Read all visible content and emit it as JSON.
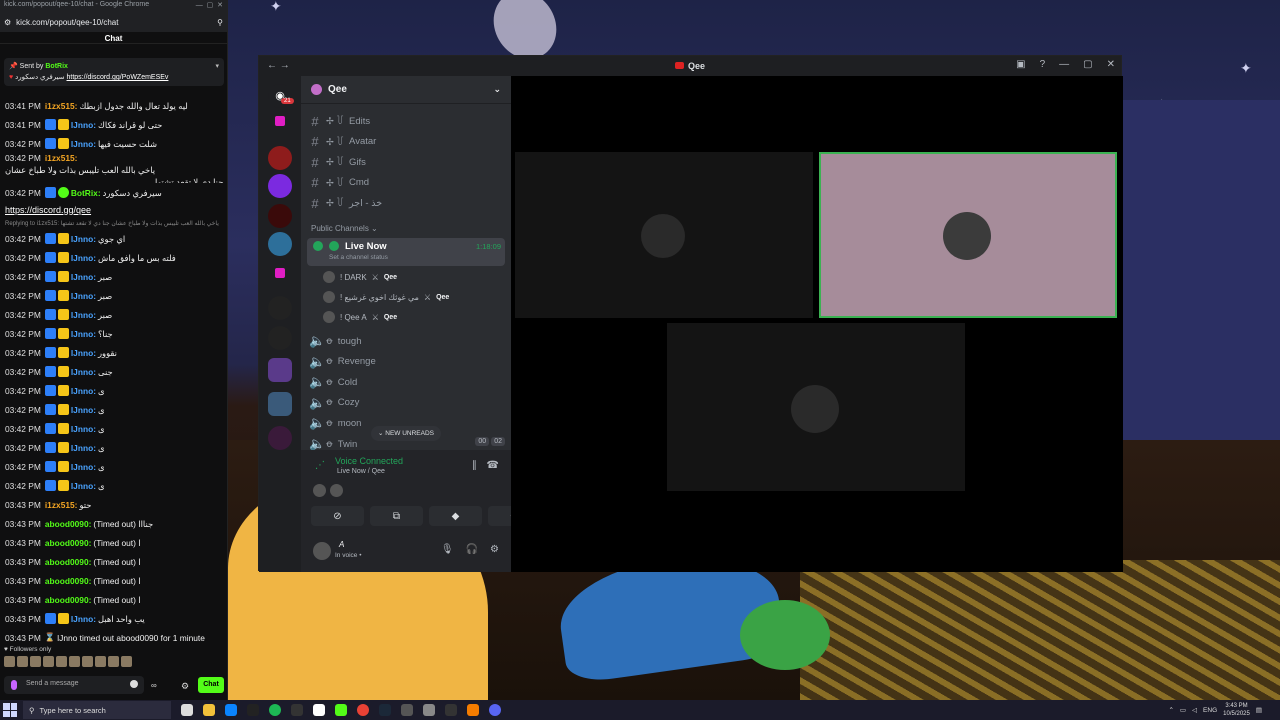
{
  "browser": {
    "title": "kick.com/popout/qee-10/chat - Google Chrome",
    "url": "kick.com/popout/qee-10/chat"
  },
  "chat": {
    "header": "Chat",
    "pinned": {
      "sent_by": "Sent by",
      "user": "BotRix",
      "text": "سيرفري دسكورد",
      "link": "https://discord.gg/PoWZemESEv"
    },
    "messages": [
      {
        "time": "03:41 PM",
        "user": "i1zx515:",
        "color": "#f5a623",
        "text": "ليه يولد تعال والله جدول ازبطك",
        "badges": 0
      },
      {
        "time": "03:41 PM",
        "user": "lJnno:",
        "color": "#4aa3ff",
        "text": "حتى لو قراند فكاك",
        "badges": 2
      },
      {
        "time": "03:42 PM",
        "user": "lJnno:",
        "color": "#4aa3ff",
        "text": "شلت حسيت فيها",
        "badges": 2
      },
      {
        "time": "03:42 PM",
        "user": "i1zx515:",
        "color": "#f5a623",
        "text": "ياخي بالله العب تليبس بذات ولا طباخ عشان",
        "text2": "جنا دي لا تقعد تشتها",
        "badges": 0,
        "two": true
      },
      {
        "time": "03:42 PM",
        "user": "BotRix:",
        "color": "#53fc18",
        "text": "سيرفري دسكورد",
        "badges": 1
      },
      {
        "link": "https://discord.gg/qee"
      },
      {
        "small": "Replying to i1zx515: ياخي بالله العب تليبس بذات ولا طباخ عشان جنا دي لا تقعد تشتها"
      },
      {
        "time": "03:42 PM",
        "user": "lJnno:",
        "color": "#4aa3ff",
        "text": "اي جوي",
        "badges": 2
      },
      {
        "time": "03:42 PM",
        "user": "lJnno:",
        "color": "#4aa3ff",
        "text": "فلته بس ما وافق ماش",
        "badges": 2
      },
      {
        "time": "03:42 PM",
        "user": "lJnno:",
        "color": "#4aa3ff",
        "text": "صبر",
        "badges": 2
      },
      {
        "time": "03:42 PM",
        "user": "lJnno:",
        "color": "#4aa3ff",
        "text": "صبر",
        "badges": 2
      },
      {
        "time": "03:42 PM",
        "user": "lJnno:",
        "color": "#4aa3ff",
        "text": "صبر",
        "badges": 2
      },
      {
        "time": "03:42 PM",
        "user": "lJnno:",
        "color": "#4aa3ff",
        "text": "جنا؟",
        "badges": 2
      },
      {
        "time": "03:42 PM",
        "user": "lJnno:",
        "color": "#4aa3ff",
        "text": "نقوور",
        "badges": 2
      },
      {
        "time": "03:42 PM",
        "user": "lJnno:",
        "color": "#4aa3ff",
        "text": "جنى",
        "badges": 2
      },
      {
        "time": "03:42 PM",
        "user": "lJnno:",
        "color": "#4aa3ff",
        "text": "ى",
        "badges": 2
      },
      {
        "time": "03:42 PM",
        "user": "lJnno:",
        "color": "#4aa3ff",
        "text": "ى",
        "badges": 2
      },
      {
        "time": "03:42 PM",
        "user": "lJnno:",
        "color": "#4aa3ff",
        "text": "ى",
        "badges": 2
      },
      {
        "time": "03:42 PM",
        "user": "lJnno:",
        "color": "#4aa3ff",
        "text": "ى",
        "badges": 2
      },
      {
        "time": "03:42 PM",
        "user": "lJnno:",
        "color": "#4aa3ff",
        "text": "ى",
        "badges": 2
      },
      {
        "time": "03:42 PM",
        "user": "lJnno:",
        "color": "#4aa3ff",
        "text": "ى",
        "badges": 2
      },
      {
        "time": "03:43 PM",
        "user": "i1zx515:",
        "color": "#f5a623",
        "text": "حتو",
        "badges": 0
      },
      {
        "time": "03:43 PM",
        "user": "abood0090:",
        "color": "#53fc18",
        "text": "(Timed out) جنااا",
        "badges": 0
      },
      {
        "time": "03:43 PM",
        "user": "abood0090:",
        "color": "#53fc18",
        "text": "(Timed out) ا",
        "badges": 0
      },
      {
        "time": "03:43 PM",
        "user": "abood0090:",
        "color": "#53fc18",
        "text": "(Timed out) ا",
        "badges": 0
      },
      {
        "time": "03:43 PM",
        "user": "abood0090:",
        "color": "#53fc18",
        "text": "(Timed out) ا",
        "badges": 0
      },
      {
        "time": "03:43 PM",
        "user": "abood0090:",
        "color": "#53fc18",
        "text": "(Timed out) ا",
        "badges": 0
      },
      {
        "time": "03:43 PM",
        "user": "lJnno:",
        "color": "#4aa3ff",
        "text": "يب واحد اهبل",
        "badges": 2
      },
      {
        "time": "03:43 PM",
        "sys": "lJnno timed out abood0090 for 1 minute"
      }
    ],
    "followers_only": "Followers only",
    "send_placeholder": "Send a message",
    "chat_button": "Chat",
    "infinity": "∞"
  },
  "discord": {
    "title": "Qee",
    "server_name": "Qee",
    "text_channels": [
      "Edits",
      "Avatar",
      "Gifs",
      "Cmd",
      "خذ - اجر"
    ],
    "category": "Public Channels",
    "live_channel": {
      "name": "Live Now",
      "status": "Set a channel status",
      "time": "1:18:09"
    },
    "voice_users": [
      {
        "name": "! DARK",
        "tag": "Qee"
      },
      {
        "name": "! مي غوثك اخوي غرشيع",
        "tag": "Qee"
      },
      {
        "name": "! Qee A",
        "tag": "Qee"
      }
    ],
    "voice_channels": [
      "tough",
      "Revenge",
      "Cold",
      "Cozy",
      "moon",
      "Twin"
    ],
    "new_unreads": "NEW UNREADS",
    "counts": [
      "00",
      "02"
    ],
    "voice_panel": {
      "title": "Voice Connected",
      "sub": "Live Now / Qee"
    },
    "user": {
      "name": "A",
      "status": "In voice •"
    },
    "badge_count": "21"
  },
  "taskbar": {
    "search": "Type here to search",
    "lang": "ENG",
    "time": "3:43 PM",
    "date": "10/5/2025"
  }
}
